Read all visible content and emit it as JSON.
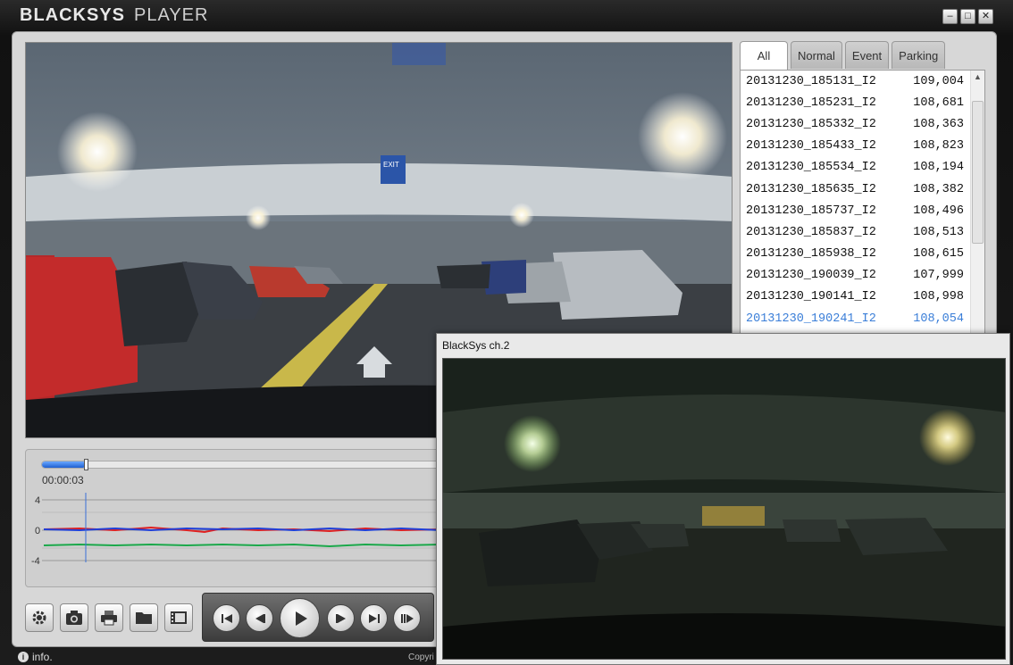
{
  "app": {
    "brand_bold": "BLACKSYS",
    "brand_light": "PLAYER"
  },
  "window_buttons": [
    "–",
    "□",
    "✕"
  ],
  "tabs": [
    {
      "label": "All",
      "active": true
    },
    {
      "label": "Normal",
      "active": false
    },
    {
      "label": "Event",
      "active": false
    },
    {
      "label": "Parking",
      "active": false
    }
  ],
  "files": [
    {
      "name": "20131230_185131_I2",
      "size": "109,004"
    },
    {
      "name": "20131230_185231_I2",
      "size": "108,681"
    },
    {
      "name": "20131230_185332_I2",
      "size": "108,363"
    },
    {
      "name": "20131230_185433_I2",
      "size": "108,823"
    },
    {
      "name": "20131230_185534_I2",
      "size": "108,194"
    },
    {
      "name": "20131230_185635_I2",
      "size": "108,382"
    },
    {
      "name": "20131230_185737_I2",
      "size": "108,496"
    },
    {
      "name": "20131230_185837_I2",
      "size": "108,513"
    },
    {
      "name": "20131230_185938_I2",
      "size": "108,615"
    },
    {
      "name": "20131230_190039_I2",
      "size": "107,999"
    },
    {
      "name": "20131230_190141_I2",
      "size": "108,998"
    },
    {
      "name": "20131230_190241_I2",
      "size": "108,054",
      "selected": true
    }
  ],
  "timeline": {
    "time": "00:00:03",
    "progress": 0.11,
    "y_ticks": [
      "4",
      "0",
      "-4"
    ]
  },
  "toolbar_icons": [
    "gear-icon",
    "camera-icon",
    "print-icon",
    "folder-icon",
    "film-icon"
  ],
  "player_icons": [
    "skip-start-icon",
    "step-back-icon",
    "play-icon",
    "step-forward-icon",
    "skip-end-icon",
    "next-frame-icon"
  ],
  "info_label": "info.",
  "copyright": "Copyri",
  "ch2": {
    "title": "BlackSys ch.2"
  },
  "video_overlay_exit": "EXIT",
  "colors": {
    "accent": "#3a7ed8",
    "graph_red": "#e02020",
    "graph_blue": "#1f3fd8",
    "graph_green": "#1aa84a"
  }
}
